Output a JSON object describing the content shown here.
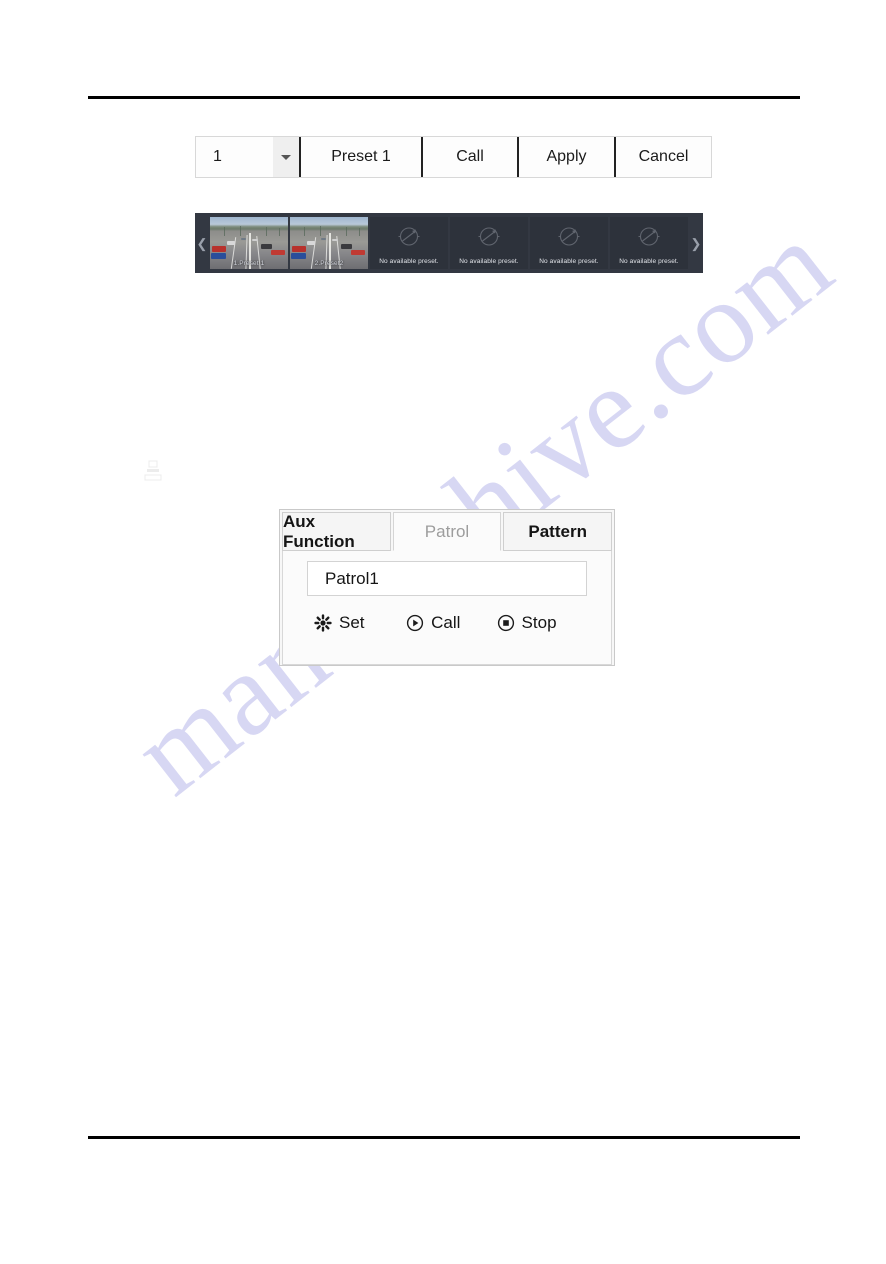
{
  "page": {
    "watermark": "manualshive.com",
    "watermark_color": "#c9c9ef",
    "rule_color": "#000000"
  },
  "preset_toolbar": {
    "name": "preset-configuration-toolbar",
    "preset_number": "1",
    "dropdown_icon": "chevron-down-icon",
    "preset_name": "Preset 1",
    "call_label": "Call",
    "apply_label": "Apply",
    "cancel_label": "Cancel"
  },
  "preset_strip": {
    "name": "preset-thumbnail-strip",
    "prev_icon": "chevron-left-icon",
    "next_icon": "chevron-right-icon",
    "background": "#333842",
    "tiles": [
      {
        "label": "1.Preset 1",
        "has_image": true,
        "empty_icon": ""
      },
      {
        "label": "2.Preset2",
        "has_image": true,
        "empty_icon": ""
      },
      {
        "label": "No available preset.",
        "has_image": false,
        "empty_icon": "no-preset-icon"
      },
      {
        "label": "No available preset.",
        "has_image": false,
        "empty_icon": "no-preset-icon"
      },
      {
        "label": "No available preset.",
        "has_image": false,
        "empty_icon": "no-preset-icon"
      },
      {
        "label": "No available preset.",
        "has_image": false,
        "empty_icon": "no-preset-icon"
      }
    ]
  },
  "ptz_panel": {
    "name": "ptz-aux-panel",
    "tabs": [
      {
        "label": "Aux Function",
        "active": false
      },
      {
        "label": "Patrol",
        "active": true
      },
      {
        "label": "Pattern",
        "active": false
      }
    ],
    "patrol_field": {
      "value": "Patrol1",
      "placeholder": "Patrol1"
    },
    "actions": [
      {
        "label": "Set",
        "icon": "gear-icon"
      },
      {
        "label": "Call",
        "icon": "play-circle-icon"
      },
      {
        "label": "Stop",
        "icon": "stop-circle-icon"
      }
    ]
  }
}
